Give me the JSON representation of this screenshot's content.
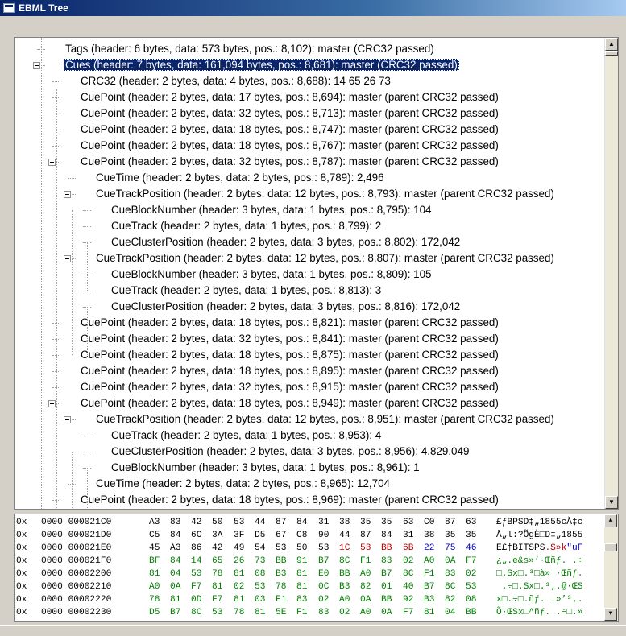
{
  "window": {
    "title": "EBML Tree"
  },
  "tree": {
    "rows": [
      {
        "text": "Tags (header: 6 bytes, data: 573 bytes, pos.: 8,102): master (CRC32 passed)"
      },
      {
        "text": "Cues (header: 7 bytes, data: 161,094 bytes, pos.: 8,681): master (CRC32 passed)",
        "selected": true
      },
      {
        "text": "CRC32 (header: 2 bytes, data: 4 bytes, pos.: 8,688): 14 65 26 73"
      },
      {
        "text": "CuePoint (header: 2 bytes, data: 17 bytes, pos.: 8,694): master (parent CRC32 passed)"
      },
      {
        "text": "CuePoint (header: 2 bytes, data: 32 bytes, pos.: 8,713): master (parent CRC32 passed)"
      },
      {
        "text": "CuePoint (header: 2 bytes, data: 18 bytes, pos.: 8,747): master (parent CRC32 passed)"
      },
      {
        "text": "CuePoint (header: 2 bytes, data: 18 bytes, pos.: 8,767): master (parent CRC32 passed)"
      },
      {
        "text": "CuePoint (header: 2 bytes, data: 32 bytes, pos.: 8,787): master (parent CRC32 passed)"
      },
      {
        "text": "CueTime (header: 2 bytes, data: 2 bytes, pos.: 8,789): 2,496"
      },
      {
        "text": "CueTrackPosition (header: 2 bytes, data: 12 bytes, pos.: 8,793): master (parent CRC32 passed)"
      },
      {
        "text": "CueBlockNumber (header: 3 bytes, data: 1 bytes, pos.: 8,795): 104"
      },
      {
        "text": "CueTrack (header: 2 bytes, data: 1 bytes, pos.: 8,799): 2"
      },
      {
        "text": "CueClusterPosition (header: 2 bytes, data: 3 bytes, pos.: 8,802): 172,042"
      },
      {
        "text": "CueTrackPosition (header: 2 bytes, data: 12 bytes, pos.: 8,807): master (parent CRC32 passed)"
      },
      {
        "text": "CueBlockNumber (header: 3 bytes, data: 1 bytes, pos.: 8,809): 105"
      },
      {
        "text": "CueTrack (header: 2 bytes, data: 1 bytes, pos.: 8,813): 3"
      },
      {
        "text": "CueClusterPosition (header: 2 bytes, data: 3 bytes, pos.: 8,816): 172,042"
      },
      {
        "text": "CuePoint (header: 2 bytes, data: 18 bytes, pos.: 8,821): master (parent CRC32 passed)"
      },
      {
        "text": "CuePoint (header: 2 bytes, data: 32 bytes, pos.: 8,841): master (parent CRC32 passed)"
      },
      {
        "text": "CuePoint (header: 2 bytes, data: 18 bytes, pos.: 8,875): master (parent CRC32 passed)"
      },
      {
        "text": "CuePoint (header: 2 bytes, data: 18 bytes, pos.: 8,895): master (parent CRC32 passed)"
      },
      {
        "text": "CuePoint (header: 2 bytes, data: 32 bytes, pos.: 8,915): master (parent CRC32 passed)"
      },
      {
        "text": "CuePoint (header: 2 bytes, data: 18 bytes, pos.: 8,949): master (parent CRC32 passed)"
      },
      {
        "text": "CueTrackPosition (header: 2 bytes, data: 12 bytes, pos.: 8,951): master (parent CRC32 passed)"
      },
      {
        "text": "CueTrack (header: 2 bytes, data: 1 bytes, pos.: 8,953): 4"
      },
      {
        "text": "CueClusterPosition (header: 2 bytes, data: 3 bytes, pos.: 8,956): 4,829,049"
      },
      {
        "text": "CueBlockNumber (header: 3 bytes, data: 1 bytes, pos.: 8,961): 1"
      },
      {
        "text": "CueTime (header: 2 bytes, data: 2 bytes, pos.: 8,965): 12,704"
      },
      {
        "text": "CuePoint (header: 2 bytes, data: 18 bytes, pos.: 8,969): master (parent CRC32 passed)"
      }
    ]
  },
  "hex": {
    "colors": {
      "plain": "#000000",
      "data": "#008000",
      "highlight_red": "#c00000",
      "highlight_blue": "#0000c0"
    },
    "rows": [
      {
        "prefix": "0x",
        "addr": "0000 000021C0",
        "bytes": [
          [
            "A3",
            "k"
          ],
          [
            "83",
            "k"
          ],
          [
            "42",
            "k"
          ],
          [
            "50",
            "k"
          ],
          [
            "53",
            "k"
          ],
          [
            "44",
            "k"
          ],
          [
            "87",
            "k"
          ],
          [
            "84",
            "k"
          ],
          [
            "31",
            "k"
          ],
          [
            "38",
            "k"
          ],
          [
            "35",
            "k"
          ],
          [
            "35",
            "k"
          ],
          [
            "63",
            "k"
          ],
          [
            "C0",
            "k"
          ],
          [
            "87",
            "k"
          ],
          [
            "63",
            "k"
          ]
        ],
        "ascii": [
          [
            "£ƒBPSD‡„1855cÀ‡c",
            "k"
          ]
        ]
      },
      {
        "prefix": "0x",
        "addr": "0000 000021D0",
        "bytes": [
          [
            "C5",
            "k"
          ],
          [
            "84",
            "k"
          ],
          [
            "6C",
            "k"
          ],
          [
            "3A",
            "k"
          ],
          [
            "3F",
            "k"
          ],
          [
            "D5",
            "k"
          ],
          [
            "67",
            "k"
          ],
          [
            "C8",
            "k"
          ],
          [
            "90",
            "k"
          ],
          [
            "44",
            "k"
          ],
          [
            "87",
            "k"
          ],
          [
            "84",
            "k"
          ],
          [
            "31",
            "k"
          ],
          [
            "38",
            "k"
          ],
          [
            "35",
            "k"
          ],
          [
            "35",
            "k"
          ]
        ],
        "ascii": [
          [
            "Å„l:?ÕgÈ□D‡„1855",
            "k"
          ]
        ]
      },
      {
        "prefix": "0x",
        "addr": "0000 000021E0",
        "bytes": [
          [
            "45",
            "k"
          ],
          [
            "A3",
            "k"
          ],
          [
            "86",
            "k"
          ],
          [
            "42",
            "k"
          ],
          [
            "49",
            "k"
          ],
          [
            "54",
            "k"
          ],
          [
            "53",
            "k"
          ],
          [
            "50",
            "k"
          ],
          [
            "53",
            "k"
          ],
          [
            "1C",
            "r"
          ],
          [
            "53",
            "r"
          ],
          [
            "BB",
            "r"
          ],
          [
            "6B",
            "r"
          ],
          [
            "22",
            "b"
          ],
          [
            "75",
            "b"
          ],
          [
            "46",
            "b"
          ]
        ],
        "ascii": [
          [
            "E£†BITSPS",
            "k"
          ],
          [
            ".S»k",
            "r"
          ],
          [
            "\"uF",
            "b"
          ]
        ]
      },
      {
        "prefix": "0x",
        "addr": "0000 000021F0",
        "bytes": [
          [
            "BF",
            "g"
          ],
          [
            "84",
            "g"
          ],
          [
            "14",
            "g"
          ],
          [
            "65",
            "g"
          ],
          [
            "26",
            "g"
          ],
          [
            "73",
            "g"
          ],
          [
            "BB",
            "g"
          ],
          [
            "91",
            "g"
          ],
          [
            "B7",
            "g"
          ],
          [
            "8C",
            "g"
          ],
          [
            "F1",
            "g"
          ],
          [
            "83",
            "g"
          ],
          [
            "02",
            "g"
          ],
          [
            "A0",
            "g"
          ],
          [
            "0A",
            "g"
          ],
          [
            "F7",
            "g"
          ]
        ],
        "ascii": [
          [
            "¿„.e&s»‘·Œñƒ. .÷",
            "g"
          ]
        ]
      },
      {
        "prefix": "0x",
        "addr": "0000 00002200",
        "bytes": [
          [
            "81",
            "g"
          ],
          [
            "04",
            "g"
          ],
          [
            "53",
            "g"
          ],
          [
            "78",
            "g"
          ],
          [
            "81",
            "g"
          ],
          [
            "08",
            "g"
          ],
          [
            "B3",
            "g"
          ],
          [
            "81",
            "g"
          ],
          [
            "E0",
            "g"
          ],
          [
            "BB",
            "g"
          ],
          [
            "A0",
            "g"
          ],
          [
            "B7",
            "g"
          ],
          [
            "8C",
            "g"
          ],
          [
            "F1",
            "g"
          ],
          [
            "83",
            "g"
          ],
          [
            "02",
            "g"
          ]
        ],
        "ascii": [
          [
            "□.Sx□.³□à» ·Œñƒ.",
            "g"
          ]
        ]
      },
      {
        "prefix": "0x",
        "addr": "0000 00002210",
        "bytes": [
          [
            "A0",
            "g"
          ],
          [
            "0A",
            "g"
          ],
          [
            "F7",
            "g"
          ],
          [
            "81",
            "g"
          ],
          [
            "02",
            "g"
          ],
          [
            "53",
            "g"
          ],
          [
            "78",
            "g"
          ],
          [
            "81",
            "g"
          ],
          [
            "0C",
            "g"
          ],
          [
            "B3",
            "g"
          ],
          [
            "82",
            "g"
          ],
          [
            "01",
            "g"
          ],
          [
            "40",
            "g"
          ],
          [
            "B7",
            "g"
          ],
          [
            "8C",
            "g"
          ],
          [
            "53",
            "g"
          ]
        ],
        "ascii": [
          [
            " .÷□.Sx□.³‚.@·ŒS",
            "g"
          ]
        ]
      },
      {
        "prefix": "0x",
        "addr": "0000 00002220",
        "bytes": [
          [
            "78",
            "g"
          ],
          [
            "81",
            "g"
          ],
          [
            "0D",
            "g"
          ],
          [
            "F7",
            "g"
          ],
          [
            "81",
            "g"
          ],
          [
            "03",
            "g"
          ],
          [
            "F1",
            "g"
          ],
          [
            "83",
            "g"
          ],
          [
            "02",
            "g"
          ],
          [
            "A0",
            "g"
          ],
          [
            "0A",
            "g"
          ],
          [
            "BB",
            "g"
          ],
          [
            "92",
            "g"
          ],
          [
            "B3",
            "g"
          ],
          [
            "82",
            "g"
          ],
          [
            "08",
            "g"
          ]
        ],
        "ascii": [
          [
            "x□.÷□.ñƒ. .»’³‚.",
            "g"
          ]
        ]
      },
      {
        "prefix": "0x",
        "addr": "0000 00002230",
        "bytes": [
          [
            "D5",
            "g"
          ],
          [
            "B7",
            "g"
          ],
          [
            "8C",
            "g"
          ],
          [
            "53",
            "g"
          ],
          [
            "78",
            "g"
          ],
          [
            "81",
            "g"
          ],
          [
            "5E",
            "g"
          ],
          [
            "F1",
            "g"
          ],
          [
            "83",
            "g"
          ],
          [
            "02",
            "g"
          ],
          [
            "A0",
            "g"
          ],
          [
            "0A",
            "g"
          ],
          [
            "F7",
            "g"
          ],
          [
            "81",
            "g"
          ],
          [
            "04",
            "g"
          ],
          [
            "BB",
            "g"
          ]
        ],
        "ascii": [
          [
            "Õ·ŒSx□^ñƒ. .÷□.»",
            "g"
          ]
        ]
      }
    ]
  }
}
